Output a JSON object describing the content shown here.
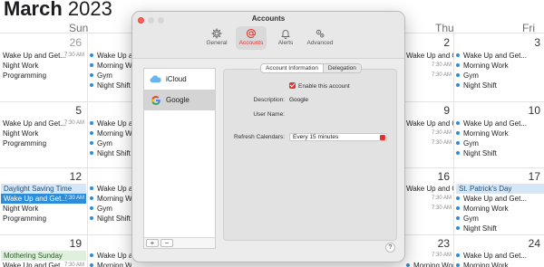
{
  "calendar": {
    "month": "March",
    "year": "2023",
    "weekdays": {
      "sun": "Sun",
      "thu": "Thu",
      "fri": "Fri"
    },
    "days": {
      "d26": "26",
      "d2": "2",
      "d3": "3",
      "d5": "5",
      "d9": "9",
      "d10": "10",
      "d12": "12",
      "d16": "16",
      "d17": "17",
      "d19": "19",
      "d23": "23",
      "d24": "24"
    },
    "events": {
      "wake": "Wake Up and Get...",
      "night_work": "Night Work",
      "programming": "Programming",
      "morning_work": "Morning Work",
      "gym": "Gym",
      "night_shift": "Night Shift",
      "dst": "Daylight Saving Time",
      "st_patrick": "St. Patrick's Day",
      "mothering": "Mothering Sunday",
      "t730": "7:30 AM",
      "t1000": "10 AM"
    }
  },
  "window": {
    "title": "Accounts",
    "toolbar": [
      {
        "label": "General",
        "icon": "gear-icon"
      },
      {
        "label": "Accounts",
        "icon": "at-icon"
      },
      {
        "label": "Alerts",
        "icon": "bell-icon"
      },
      {
        "label": "Advanced",
        "icon": "gears-icon"
      }
    ],
    "accounts": [
      {
        "label": "iCloud",
        "icon": "icloud-icon"
      },
      {
        "label": "Google",
        "icon": "google-icon"
      }
    ],
    "add_label": "+",
    "remove_label": "−",
    "tabs": {
      "info": "Account Information",
      "delegation": "Delegation"
    },
    "enable_label": "Enable this account",
    "description_label": "Description:",
    "description_value": "Google",
    "username_label": "User Name:",
    "username_value": "",
    "refresh_label": "Refresh Calendars:",
    "refresh_value": "Every 15 minutes",
    "help_label": "?"
  },
  "colors": {
    "accent": "#e5312c",
    "event_blue": "#2d8dd8",
    "event_fill": "#d5e7f7"
  }
}
